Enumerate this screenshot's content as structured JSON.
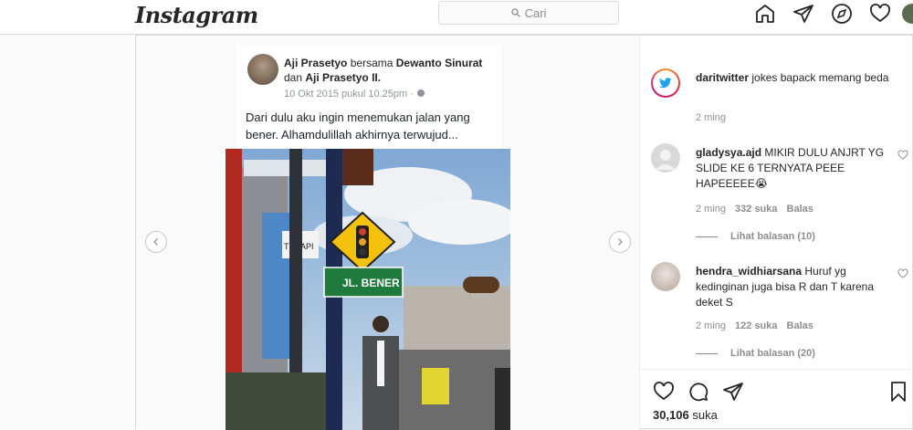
{
  "header": {
    "logo": "Instagram",
    "search_placeholder": "Cari"
  },
  "fb_post": {
    "author": "Aji Prasetyo",
    "with_text": "bersama",
    "tagged1": "Dewanto Sinurat",
    "and_text": "dan",
    "tagged2": "Aji Prasetyo II",
    "date": "10 Okt 2015 pukul 10.25pm · ",
    "text": "Dari dulu aku ingin menemukan jalan yang bener. Alhamdulillah akhirnya terwujud..."
  },
  "photo": {
    "sign_name": "JL. BENER",
    "shop_sign": "TERAPI"
  },
  "caption": {
    "username": "daritwitter",
    "text": "jokes bapack memang beda",
    "time": "2 ming"
  },
  "comments": [
    {
      "username": "gladysya.ajd",
      "text": "MIKIR DULU ANJRT YG SLIDE KE 6 TERNYATA PEEE HAPEEEEE😭",
      "time": "2 ming",
      "likes": "332 suka",
      "reply": "Balas",
      "view_replies": "Lihat balasan (10)"
    },
    {
      "username": "hendra_widhiarsana",
      "text": "Huruf yg kedinginan juga bisa R dan T karena deket S",
      "time": "2 ming",
      "likes": "122 suka",
      "reply": "Balas",
      "view_replies": "Lihat balasan (20)"
    }
  ],
  "post_footer": {
    "likes_count": "30,106",
    "likes_label": "suka"
  },
  "icons": [
    "home-icon",
    "direct-icon",
    "explore-icon",
    "heart-icon",
    "search-icon",
    "like-icon",
    "comment-icon",
    "share-icon",
    "bookmark-icon",
    "chevron-left-icon",
    "chevron-right-icon"
  ],
  "colors": {
    "accent": "#0095f6",
    "border": "#dbdbdb",
    "muted": "#8e8e8e"
  }
}
